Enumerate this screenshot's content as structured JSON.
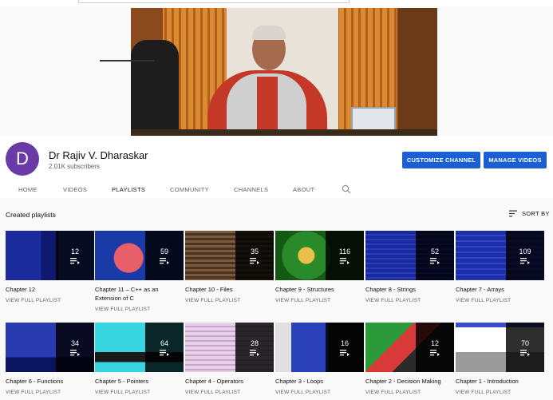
{
  "channel": {
    "avatar_letter": "D",
    "name": "Dr Rajiv V. Dharaskar",
    "subscribers": "2.01K subscribers",
    "customize_label": "CUSTOMIZE CHANNEL",
    "manage_label": "MANAGE VIDEOS",
    "accent_color": "#1a5fd3",
    "avatar_color": "#6a3aa6"
  },
  "tabs": [
    {
      "label": "HOME"
    },
    {
      "label": "VIDEOS"
    },
    {
      "label": "PLAYLISTS",
      "active": true
    },
    {
      "label": "COMMUNITY"
    },
    {
      "label": "CHANNELS"
    },
    {
      "label": "ABOUT"
    }
  ],
  "section": {
    "title": "Created playlists",
    "sort_label": "SORT BY"
  },
  "view_full_label": "VIEW FULL PLAYLIST",
  "playlists": [
    {
      "title": "Chapter 12",
      "count": "12"
    },
    {
      "title": "Chapter 11 – C++ as an Extension of C",
      "count": "59"
    },
    {
      "title": "Chapter 10 - Files",
      "count": "35"
    },
    {
      "title": "Chapter 9 - Structures",
      "count": "116"
    },
    {
      "title": "Chapter 8 - Strings",
      "count": "52"
    },
    {
      "title": "Chapter 7 - Arrays",
      "count": "109"
    },
    {
      "title": "Chapter 6 - Functions",
      "count": "34"
    },
    {
      "title": "Chapter 5 - Pointers",
      "count": "64"
    },
    {
      "title": "Chapter 4 - Operators",
      "count": "28"
    },
    {
      "title": "Chapter 3 - Loops",
      "count": "16"
    },
    {
      "title": "Chapter 2 - Decision Making",
      "count": "12"
    },
    {
      "title": "Chapter 1 - Introduction",
      "count": "70"
    }
  ]
}
